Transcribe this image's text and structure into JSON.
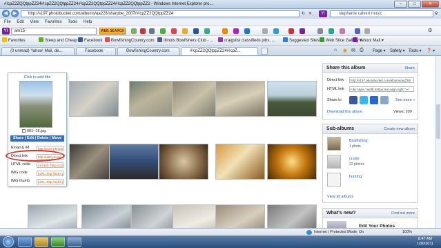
{
  "window": {
    "title": "#!cpZ2ZQQtppZZ24#!cpZZ2QQtppZZ24#!cpZZ2QQtppZZ24#!cpZZ2QQtppZZ2 - Windows Internet Explorer pro..."
  },
  "titlebar_buttons": [
    "–",
    "□",
    "✕"
  ],
  "address": {
    "url": "http://s197.photobucket.com/albums/aa228/sharpbe_2007/#!cpZZ2QQtppZZ24",
    "search_value": "stephanie calvert music",
    "search_provider_icon": "yahoo-icon"
  },
  "menu": [
    "File",
    "Edit",
    "View",
    "Favorites",
    "Tools",
    "Help"
  ],
  "yahoo_toolbar": {
    "search_value": "am15",
    "web_search_label": "WEB SEARCH"
  },
  "favorites_bar": {
    "favorites_label": "Favorites",
    "items": [
      "Steep and Cheap",
      "Facebook",
      "BowfishingCountry.com",
      "Illinois Bowfishers Club - ...",
      "craigslist classifieds jobs, ...",
      "Suggested Sites ▾",
      "Web Slice Gallery ▾",
      "Yahoo! Mail ▾"
    ]
  },
  "tabs": [
    "(0 unread) Yahoo! Mail, de...",
    "Facebook",
    "BowfishingCountry.com",
    "#!cpZZ2QQtppZZ24#!cpZ..."
  ],
  "command_bar": [
    "Page ▾",
    "Safety ▾",
    "Tools ▾",
    "❓ ▾"
  ],
  "popup": {
    "add_title": "Click to add title",
    "filename": "001~15.jpg",
    "actions": "Share | Edit | Delete | Move",
    "rows": [
      {
        "label": "Email & IM",
        "value": "http://s197.photob"
      },
      {
        "label": "Direct link",
        "value": "http://i197.photobu"
      },
      {
        "label": "HTML code",
        "value": "<a href=\"http://s197"
      },
      {
        "label": "IMG code",
        "value": "[URL=http://s197.ph"
      },
      {
        "label": "IMG thumb",
        "value": "[URL=http://s197.ph"
      }
    ]
  },
  "share_album": {
    "title": "Share this album",
    "share_link": "Share",
    "direct_label": "Direct link",
    "direct_value": "http://s197.photobucket.com/albums/aa228/",
    "html_label": "HTML link",
    "html_value": "<div style=\"width:480px;text-align:right;\"><",
    "share_to_label": "Share to",
    "more_label": "See more »",
    "download_label": "Download this album",
    "views_label": "Views: 209"
  },
  "sub_albums": {
    "title": "Sub-albums",
    "create_label": "Create new album",
    "items": [
      {
        "name": "Bowfishing",
        "count": "1 photo"
      },
      {
        "name": "cruise",
        "count": "22 photos"
      },
      {
        "name": "hunting",
        "count": ""
      }
    ],
    "view_all": "View all albums"
  },
  "whats_new": {
    "title": "What's new?",
    "find_out_more": "Find out more",
    "edit_photos": "Edit Your Photos"
  },
  "status_bar": {
    "zone": "Internet | Protected Mode: On",
    "zoom": "100%"
  },
  "taskbar": {
    "time": "8:47 AM",
    "date": "1/30/2011"
  }
}
